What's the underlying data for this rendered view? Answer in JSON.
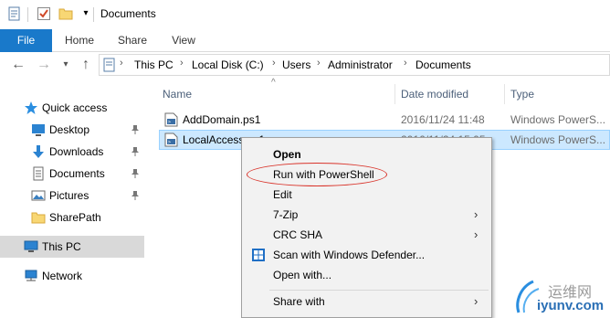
{
  "window": {
    "title": "Documents",
    "quick_access_toolbar": [
      "properties-icon",
      "checkmark-icon",
      "new-folder-icon",
      "customize-dropdown-icon"
    ]
  },
  "ribbon": {
    "tabs": [
      "File",
      "Home",
      "Share",
      "View"
    ]
  },
  "address_bar": {
    "breadcrumbs": [
      "This PC",
      "Local Disk (C:)",
      "Users",
      "Administrator",
      "Documents"
    ]
  },
  "nav_pane": {
    "items": [
      {
        "label": "Quick access",
        "icon": "star-icon",
        "pinned": false
      },
      {
        "label": "Desktop",
        "icon": "desktop-icon",
        "pinned": true
      },
      {
        "label": "Downloads",
        "icon": "download-arrow-icon",
        "pinned": true
      },
      {
        "label": "Documents",
        "icon": "documents-icon",
        "pinned": true
      },
      {
        "label": "Pictures",
        "icon": "pictures-icon",
        "pinned": true
      },
      {
        "label": "SharePath",
        "icon": "folder-icon",
        "pinned": false
      },
      {
        "label": "This PC",
        "icon": "computer-icon",
        "pinned": false,
        "selected": true
      },
      {
        "label": "Network",
        "icon": "network-icon",
        "pinned": false
      }
    ]
  },
  "file_list": {
    "columns": [
      "Name",
      "Date modified",
      "Type"
    ],
    "rows": [
      {
        "name": "AddDomain.ps1",
        "date": "2016/11/24 11:48",
        "type": "Windows PowerS..."
      },
      {
        "name": "LocalAccess.ps1",
        "date": "2016/11/24 15:05",
        "type": "Windows PowerS...",
        "selected": true
      }
    ]
  },
  "context_menu": {
    "items": [
      {
        "label": "Open",
        "bold": true
      },
      {
        "label": "Run with PowerShell",
        "highlighted": true
      },
      {
        "label": "Edit"
      },
      {
        "label": "7-Zip",
        "submenu": true
      },
      {
        "label": "CRC SHA",
        "submenu": true
      },
      {
        "label": "Scan with Windows Defender...",
        "icon": "windows-defender-icon"
      },
      {
        "label": "Open with..."
      },
      {
        "separator": true
      },
      {
        "label": "Share with",
        "submenu": true
      }
    ]
  },
  "watermark": {
    "line1": "运维网",
    "line2": "iyunv.com"
  },
  "colors": {
    "file_tab": "#1979ca",
    "selection": "#cce8ff",
    "highlight_ellipse": "#d9342b"
  }
}
